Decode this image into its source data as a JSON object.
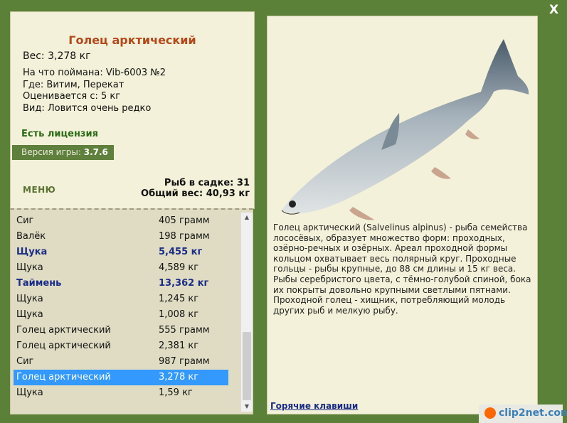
{
  "window": {
    "close_label": "X"
  },
  "info": {
    "title": "Голец арктический",
    "weight": "Вес: 3,278 кг",
    "details": [
      "На что поймана: Vib-6003 №2",
      "Где: Витим, Перекат",
      "Оценивается с: 5 кг",
      "Вид: Ловится очень редко"
    ],
    "license": "Есть лицензия",
    "version_label": "Версия игры:",
    "version_value": "3.7.6",
    "menu_label": "МЕНЮ",
    "fish_count": "Рыб в садке: 31",
    "total_weight": "Общий вес: 40,93 кг"
  },
  "catch_list": [
    {
      "name": "Сиг",
      "weight": "405 грамм"
    },
    {
      "name": "Валёк",
      "weight": "198 грамм"
    },
    {
      "name": "Щука",
      "weight": "5,455 кг",
      "trophy": true
    },
    {
      "name": "Щука",
      "weight": "4,589 кг"
    },
    {
      "name": "Таймень",
      "weight": "13,362 кг",
      "trophy": true
    },
    {
      "name": "Щука",
      "weight": "1,245 кг"
    },
    {
      "name": "Щука",
      "weight": "1,008 кг"
    },
    {
      "name": "Голец арктический",
      "weight": "555 грамм"
    },
    {
      "name": "Голец арктический",
      "weight": "2,381 кг"
    },
    {
      "name": "Сиг",
      "weight": "987 грамм"
    },
    {
      "name": "Голец арктический",
      "weight": "3,278 кг",
      "selected": true
    },
    {
      "name": "Щука",
      "weight": "1,59 кг"
    }
  ],
  "description": "Голец арктический (Salvelinus alpinus) - рыба семейства лососёвых, образует множество форм: проходных, озёрно-речных и озёрных. Ареал проходной формы кольцом охватывает весь полярный круг. Проходные гольцы - рыбы крупные, до 88 см длины и 15 кг веса. Рыбы серебристого цвета, с тёмно-голубой спиной, бока их покрыты довольно крупными светлыми пятнами. Проходной голец - хищник, потребляющий молодь других рыб и мелкую рыбу.",
  "hotkeys_label": "Горячие клавиши",
  "watermark": "clip2net.com",
  "colors": {
    "frame": "#5b8037",
    "panel": "#f3f1d9",
    "title": "#b5481a",
    "license": "#2d6a17",
    "trophy": "#1b2c88",
    "selection": "#3399ff"
  }
}
